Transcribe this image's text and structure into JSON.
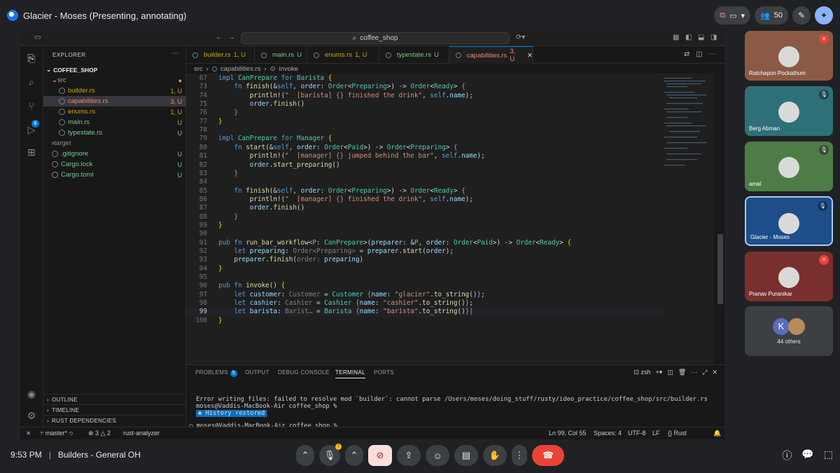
{
  "meet": {
    "tab_title": "Glacier - Moses (Presenting, annotating)",
    "participant_count": "50",
    "time": "9:53 PM",
    "meeting_name": "Builders - General OH",
    "others_label": "44 others",
    "participants": [
      {
        "name": "Ratchapon Pockathum",
        "bg": "#8a5a44",
        "muted": true
      },
      {
        "name": "Berg Abman",
        "bg": "#2f6f77",
        "muted": false
      },
      {
        "name": "amal",
        "bg": "#4d7c46",
        "muted": false
      },
      {
        "name": "Glacier - Moses",
        "bg": "#1d4e89",
        "muted": false
      },
      {
        "name": "Pranav Puranikar",
        "bg": "#7a2f2f",
        "muted": true
      }
    ]
  },
  "vscode": {
    "search_text": "coffee_shop",
    "explorer_header": "EXPLORER",
    "project": "COFFEE_SHOP",
    "tree": [
      {
        "name": "src",
        "status": "●",
        "color": "#f48771",
        "indent": 12
      },
      {
        "name": "builder.rs",
        "status": "1, U",
        "color": "#cca700",
        "indent": 22
      },
      {
        "name": "capabilities.rs",
        "status": "3, U",
        "color": "#f48771",
        "indent": 22,
        "selected": true
      },
      {
        "name": "enums.rs",
        "status": "1, U",
        "color": "#cca700",
        "indent": 22
      },
      {
        "name": "main.rs",
        "status": "U",
        "color": "#73c991",
        "indent": 22
      },
      {
        "name": "typestate.rs",
        "status": "U",
        "color": "#73c991",
        "indent": 22
      },
      {
        "name": "target",
        "status": "",
        "color": "#8c8c8c",
        "indent": 12
      },
      {
        "name": ".gitignore",
        "status": "U",
        "color": "#73c991",
        "indent": 12
      },
      {
        "name": "Cargo.lock",
        "status": "U",
        "color": "#73c991",
        "indent": 12
      },
      {
        "name": "Cargo.toml",
        "status": "U",
        "color": "#73c991",
        "indent": 12
      }
    ],
    "outline": "OUTLINE",
    "timeline": "TIMELINE",
    "rust_deps": "RUST DEPENDENCIES",
    "tabs": [
      {
        "name": "builder.rs",
        "status": "1, U",
        "color": "#cca700"
      },
      {
        "name": "main.rs",
        "status": "U",
        "color": "#73c991"
      },
      {
        "name": "enums.rs",
        "status": "1, U",
        "color": "#cca700"
      },
      {
        "name": "typestate.rs",
        "status": "U",
        "color": "#73c991"
      },
      {
        "name": "capabilities.rs",
        "status": "3, U",
        "color": "#f48771"
      }
    ],
    "breadcrumb": [
      "src",
      "capabilities.rs",
      "invoke"
    ],
    "code": [
      [
        "67",
        [
          [
            "k",
            "impl "
          ],
          [
            "t",
            "CanPrepare "
          ],
          [
            "k",
            "for "
          ],
          [
            "t",
            "Barista "
          ],
          [
            "y",
            "{"
          ]
        ]
      ],
      [
        "73",
        [
          [
            "p",
            "    "
          ],
          [
            "k",
            "fn "
          ],
          [
            "f",
            "finish"
          ],
          [
            "p",
            "(&"
          ],
          [
            "k",
            "self"
          ],
          [
            "p",
            ", "
          ],
          [
            "v",
            "order"
          ],
          [
            "p",
            ": "
          ],
          [
            "t",
            "Order"
          ],
          [
            "p",
            "<"
          ],
          [
            "t",
            "Preparing"
          ],
          [
            "p",
            ">) -> "
          ],
          [
            "t",
            "Order"
          ],
          [
            "p",
            "<"
          ],
          [
            "t",
            "Ready"
          ],
          [
            "p",
            "> "
          ],
          [
            "m",
            "{"
          ]
        ]
      ],
      [
        "74",
        [
          [
            "p",
            "        "
          ],
          [
            "f",
            "println!"
          ],
          [
            "p",
            "("
          ],
          [
            "s",
            "\"  [barista] {} finished the drink\""
          ],
          [
            "p",
            ", "
          ],
          [
            "k",
            "self"
          ],
          [
            "p",
            "."
          ],
          [
            "v",
            "name"
          ],
          [
            "p",
            ");"
          ]
        ]
      ],
      [
        "75",
        [
          [
            "p",
            "        "
          ],
          [
            "v",
            "order"
          ],
          [
            "p",
            "."
          ],
          [
            "f",
            "finish"
          ],
          [
            "p",
            "()"
          ]
        ]
      ],
      [
        "76",
        [
          [
            "p",
            "    "
          ],
          [
            "m",
            "}"
          ]
        ]
      ],
      [
        "77",
        [
          [
            "y",
            "}"
          ]
        ]
      ],
      [
        "78",
        []
      ],
      [
        "79",
        [
          [
            "k",
            "impl "
          ],
          [
            "t",
            "CanPrepare "
          ],
          [
            "k",
            "for "
          ],
          [
            "t",
            "Manager "
          ],
          [
            "y",
            "{"
          ]
        ]
      ],
      [
        "80",
        [
          [
            "p",
            "    "
          ],
          [
            "k",
            "fn "
          ],
          [
            "f",
            "start"
          ],
          [
            "p",
            "(&"
          ],
          [
            "k",
            "self"
          ],
          [
            "p",
            ", "
          ],
          [
            "v",
            "order"
          ],
          [
            "p",
            ": "
          ],
          [
            "t",
            "Order"
          ],
          [
            "p",
            "<"
          ],
          [
            "t",
            "Paid"
          ],
          [
            "p",
            ">) -> "
          ],
          [
            "t",
            "Order"
          ],
          [
            "p",
            "<"
          ],
          [
            "t",
            "Preparing"
          ],
          [
            "p",
            "> "
          ],
          [
            "m",
            "{"
          ]
        ]
      ],
      [
        "81",
        [
          [
            "p",
            "        "
          ],
          [
            "f",
            "println!"
          ],
          [
            "p",
            "("
          ],
          [
            "s",
            "\"  [manager] {} jumped behind the bar\""
          ],
          [
            "p",
            ", "
          ],
          [
            "k",
            "self"
          ],
          [
            "p",
            "."
          ],
          [
            "v",
            "name"
          ],
          [
            "p",
            ");"
          ]
        ]
      ],
      [
        "82",
        [
          [
            "p",
            "        "
          ],
          [
            "v",
            "order"
          ],
          [
            "p",
            "."
          ],
          [
            "f",
            "start_preparing"
          ],
          [
            "p",
            "()"
          ]
        ]
      ],
      [
        "83",
        [
          [
            "p",
            "    "
          ],
          [
            "m",
            "}"
          ]
        ]
      ],
      [
        "84",
        []
      ],
      [
        "85",
        [
          [
            "p",
            "    "
          ],
          [
            "k",
            "fn "
          ],
          [
            "f",
            "finish"
          ],
          [
            "p",
            "(&"
          ],
          [
            "k",
            "self"
          ],
          [
            "p",
            ", "
          ],
          [
            "v",
            "order"
          ],
          [
            "p",
            ": "
          ],
          [
            "t",
            "Order"
          ],
          [
            "p",
            "<"
          ],
          [
            "t",
            "Preparing"
          ],
          [
            "p",
            ">) -> "
          ],
          [
            "t",
            "Order"
          ],
          [
            "p",
            "<"
          ],
          [
            "t",
            "Ready"
          ],
          [
            "p",
            "> "
          ],
          [
            "m",
            "{"
          ]
        ]
      ],
      [
        "86",
        [
          [
            "p",
            "        "
          ],
          [
            "f",
            "println!"
          ],
          [
            "p",
            "("
          ],
          [
            "s",
            "\"  [manager] {} finished the drink\""
          ],
          [
            "p",
            ", "
          ],
          [
            "k",
            "self"
          ],
          [
            "p",
            "."
          ],
          [
            "v",
            "name"
          ],
          [
            "p",
            ");"
          ]
        ]
      ],
      [
        "87",
        [
          [
            "p",
            "        "
          ],
          [
            "v",
            "order"
          ],
          [
            "p",
            "."
          ],
          [
            "f",
            "finish"
          ],
          [
            "p",
            "()"
          ]
        ]
      ],
      [
        "88",
        [
          [
            "p",
            "    "
          ],
          [
            "m",
            "}"
          ]
        ]
      ],
      [
        "89",
        [
          [
            "y",
            "}"
          ]
        ]
      ],
      [
        "90",
        []
      ],
      [
        "91",
        [
          [
            "k",
            "pub fn "
          ],
          [
            "f",
            "run_bar_workflow"
          ],
          [
            "p",
            "<"
          ],
          [
            "t",
            "P"
          ],
          [
            "p",
            ": "
          ],
          [
            "t",
            "CanPrepare"
          ],
          [
            "p",
            ">("
          ],
          [
            "v",
            "preparer"
          ],
          [
            "p",
            ": &"
          ],
          [
            "t",
            "P"
          ],
          [
            "p",
            ", "
          ],
          [
            "v",
            "order"
          ],
          [
            "p",
            ": "
          ],
          [
            "t",
            "Order"
          ],
          [
            "p",
            "<"
          ],
          [
            "t",
            "Paid"
          ],
          [
            "p",
            ">) -> "
          ],
          [
            "t",
            "Order"
          ],
          [
            "p",
            "<"
          ],
          [
            "t",
            "Ready"
          ],
          [
            "p",
            "> "
          ],
          [
            "y",
            "{"
          ]
        ]
      ],
      [
        "92",
        [
          [
            "p",
            "    "
          ],
          [
            "k",
            "let "
          ],
          [
            "v",
            "preparing"
          ],
          [
            "p",
            ": "
          ],
          [
            "g",
            "Order<Preparing>"
          ],
          [
            "p",
            " = "
          ],
          [
            "v",
            "preparer"
          ],
          [
            "p",
            "."
          ],
          [
            "f",
            "start"
          ],
          [
            "p",
            "("
          ],
          [
            "v",
            "order"
          ],
          [
            "p",
            ");"
          ]
        ]
      ],
      [
        "93",
        [
          [
            "p",
            "    "
          ],
          [
            "v",
            "preparer"
          ],
          [
            "p",
            "."
          ],
          [
            "f",
            "finish"
          ],
          [
            "p",
            "("
          ],
          [
            "g",
            "order: "
          ],
          [
            "v",
            "preparing"
          ],
          [
            "p",
            ")"
          ]
        ]
      ],
      [
        "94",
        [
          [
            "y",
            "}"
          ]
        ]
      ],
      [
        "95",
        []
      ],
      [
        "96",
        [
          [
            "k",
            "pub fn "
          ],
          [
            "f",
            "invoke"
          ],
          [
            "p",
            "() "
          ],
          [
            "y",
            "{"
          ]
        ]
      ],
      [
        "97",
        [
          [
            "p",
            "    "
          ],
          [
            "k",
            "let "
          ],
          [
            "v",
            "customer"
          ],
          [
            "p",
            ": "
          ],
          [
            "g",
            "Customer"
          ],
          [
            "p",
            " = "
          ],
          [
            "t",
            "Customer "
          ],
          [
            "m",
            "{"
          ],
          [
            "v",
            "name"
          ],
          [
            "p",
            ": "
          ],
          [
            "s",
            "\"glacier\""
          ],
          [
            "p",
            "."
          ],
          [
            "f",
            "to_string"
          ],
          [
            "p",
            "()"
          ],
          [
            "m",
            "}"
          ],
          [
            "p",
            ";"
          ]
        ]
      ],
      [
        "98",
        [
          [
            "p",
            "    "
          ],
          [
            "k",
            "let "
          ],
          [
            "v",
            "cashier"
          ],
          [
            "p",
            ": "
          ],
          [
            "g",
            "Cashier"
          ],
          [
            "p",
            " = "
          ],
          [
            "t",
            "Cashier "
          ],
          [
            "m",
            "{"
          ],
          [
            "v",
            "name"
          ],
          [
            "p",
            ": "
          ],
          [
            "s",
            "\"cashier\""
          ],
          [
            "p",
            "."
          ],
          [
            "f",
            "to_string"
          ],
          [
            "p",
            "()"
          ],
          [
            "m",
            "}"
          ],
          [
            "p",
            ";"
          ]
        ]
      ],
      [
        "99",
        [
          [
            "p",
            "    "
          ],
          [
            "k",
            "let "
          ],
          [
            "v",
            "barista"
          ],
          [
            "p",
            ": "
          ],
          [
            "g",
            "Barist…"
          ],
          [
            "p",
            " = "
          ],
          [
            "t",
            "Barista "
          ],
          [
            "m",
            "{"
          ],
          [
            "v",
            "name"
          ],
          [
            "p",
            ": "
          ],
          [
            "s",
            "\"barista\""
          ],
          [
            "p",
            "."
          ],
          [
            "f",
            "to_string"
          ],
          [
            "p",
            "()"
          ],
          [
            "m",
            "}"
          ]
        ]
      ],
      [
        "100",
        [
          [
            "y",
            "}"
          ]
        ]
      ]
    ],
    "current_line": "99",
    "panel_tabs": [
      "PROBLEMS",
      "OUTPUT",
      "DEBUG CONSOLE",
      "TERMINAL",
      "PORTS"
    ],
    "problems_count": "5",
    "shell": "zsh",
    "terminal": {
      "error": "Error writing files: failed to resolve mod `builder`: cannot parse /Users/moses/doing_stuff/rusty/ideo_practice/coffee_shop/src/builder.rs",
      "prompt1": "moses@Vaddis-MacBook-Air coffee_shop %",
      "history": "History restored",
      "prompt2": "moses@Vaddis-MacBook-Air coffee_shop %"
    },
    "status": {
      "branch": "master*",
      "errors": "3",
      "warnings": "2",
      "analyzer": "rust-analyzer",
      "position": "Ln 99, Col 55",
      "spaces": "Spaces: 4",
      "encoding": "UTF-8",
      "eol": "LF",
      "language": "Rust"
    }
  }
}
